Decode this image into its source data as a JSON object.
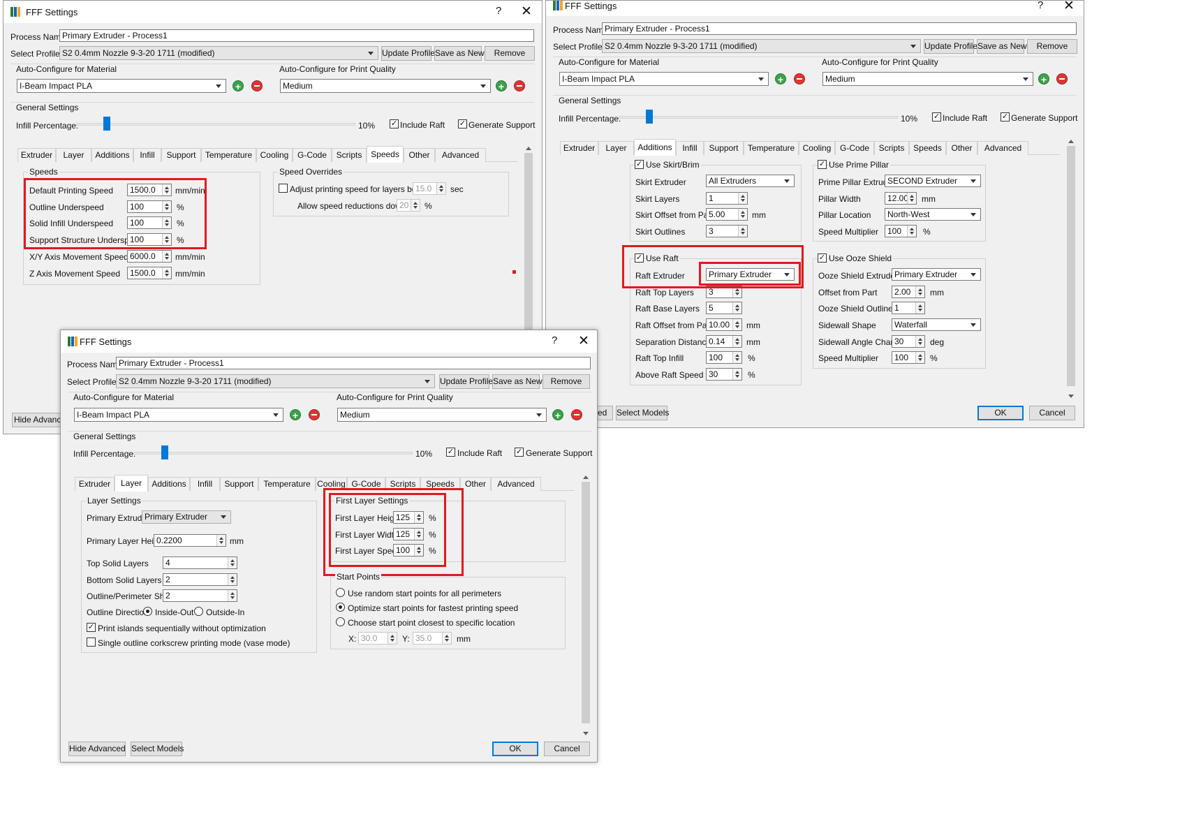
{
  "titles": {
    "win": "FFF Settings",
    "help": "?",
    "close": "✕"
  },
  "labels": {
    "process_name": "Process Name:",
    "select_profile": "Select Profile:",
    "autoconf_material": "Auto-Configure for Material",
    "autoconf_quality": "Auto-Configure for Print Quality",
    "general_settings": "General Settings",
    "infill_percentage": "Infill Percentage:",
    "infill_value": "10%",
    "include_raft": "Include Raft",
    "generate_support": "Generate Support"
  },
  "values": {
    "process_name": "Primary Extruder - Process1",
    "profile": "S2 0.4mm Nozzle 9-3-20 1711 (modified)",
    "material": "I-Beam Impact PLA",
    "quality": "Medium"
  },
  "buttons": {
    "update_profile": "Update Profile",
    "save_as_new": "Save as New",
    "remove": "Remove",
    "hide_advanced": "Hide Advanced",
    "hide_advanced_partial": "Hide Advance",
    "select_models": "Select Models",
    "ok": "OK",
    "cancel": "Cancel",
    "ed_partial": "ed"
  },
  "tabs": {
    "extruder": "Extruder",
    "layer": "Layer",
    "additions": "Additions",
    "infill": "Infill",
    "support": "Support",
    "temperature": "Temperature",
    "cooling": "Cooling",
    "gcode": "G-Code",
    "scripts": "Scripts",
    "speeds": "Speeds",
    "other": "Other",
    "advanced": "Advanced"
  },
  "speeds": {
    "group": "Speeds",
    "rows": [
      {
        "label": "Default Printing Speed",
        "value": "1500.0",
        "unit": "mm/min"
      },
      {
        "label": "Outline Underspeed",
        "value": "100",
        "unit": "%"
      },
      {
        "label": "Solid Infill Underspeed",
        "value": "100",
        "unit": "%"
      },
      {
        "label": "Support Structure Underspeed",
        "value": "100",
        "unit": "%"
      },
      {
        "label": "X/Y Axis Movement Speed",
        "value": "6000.0",
        "unit": "mm/min"
      },
      {
        "label": "Z Axis Movement Speed",
        "value": "1500.0",
        "unit": "mm/min"
      }
    ],
    "overrides_group": "Speed Overrides",
    "adjust_label": "Adjust printing speed for layers below",
    "adjust_value": "15.0",
    "adjust_unit": "sec",
    "allow_label": "Allow speed reductions down to",
    "allow_value": "20",
    "allow_unit": "%"
  },
  "additions": {
    "skirt_title": "Use Skirt/Brim",
    "skirt_extruder_label": "Skirt Extruder",
    "skirt_extruder": "All Extruders",
    "skirt_layers_label": "Skirt Layers",
    "skirt_layers": "1",
    "skirt_offset_label": "Skirt Offset from Part",
    "skirt_offset": "5.00",
    "skirt_offset_unit": "mm",
    "skirt_outlines_label": "Skirt Outlines",
    "skirt_outlines": "3",
    "raft_title": "Use Raft",
    "raft_extruder_label": "Raft Extruder",
    "raft_extruder": "Primary Extruder",
    "raft_top_label": "Raft Top Layers",
    "raft_top": "3",
    "raft_base_label": "Raft Base Layers",
    "raft_base": "5",
    "raft_offset_label": "Raft Offset from Part",
    "raft_offset": "10.00",
    "raft_offset_unit": "mm",
    "sep_label": "Separation Distance",
    "sep_value": "0.14",
    "sep_unit": "mm",
    "raft_infill_label": "Raft Top Infill",
    "raft_infill": "100",
    "raft_infill_unit": "%",
    "above_label": "Above Raft Speed",
    "above_value": "30",
    "above_unit": "%",
    "pillar_title": "Use Prime Pillar",
    "pillar_extruder_label": "Prime Pillar Extruder",
    "pillar_extruder": "SECOND Extruder",
    "pillar_width_label": "Pillar Width",
    "pillar_width": "12.00",
    "pillar_width_unit": "mm",
    "pillar_loc_label": "Pillar Location",
    "pillar_loc": "North-West",
    "pillar_speed_label": "Speed Multiplier",
    "pillar_speed": "100",
    "pillar_speed_unit": "%",
    "ooze_title": "Use Ooze Shield",
    "ooze_extruder_label": "Ooze Shield Extruder",
    "ooze_extruder": "Primary Extruder",
    "ooze_offset_label": "Offset from Part",
    "ooze_offset": "2.00",
    "ooze_offset_unit": "mm",
    "ooze_outlines_label": "Ooze Shield Outlines",
    "ooze_outlines": "1",
    "sidewall_label": "Sidewall Shape",
    "sidewall": "Waterfall",
    "angle_label": "Sidewall Angle Change",
    "angle": "30",
    "angle_unit": "deg",
    "ooze_speed_label": "Speed Multiplier",
    "ooze_speed": "100",
    "ooze_speed_unit": "%"
  },
  "layer": {
    "group": "Layer Settings",
    "primary_extruder_label": "Primary Extruder",
    "primary_extruder": "Primary Extruder",
    "primary_height_label": "Primary Layer Height",
    "primary_height": "0.2200",
    "primary_height_unit": "mm",
    "top_label": "Top Solid Layers",
    "top": "4",
    "bottom_label": "Bottom Solid Layers",
    "bottom": "2",
    "outline_label": "Outline/Perimeter Shells",
    "outline": "2",
    "direction_label": "Outline Direction:",
    "inside_out": "Inside-Out",
    "outside_in": "Outside-In",
    "islands": "Print islands sequentially without optimization",
    "vase": "Single outline corkscrew printing mode (vase mode)",
    "first_group": "First Layer Settings",
    "first_height_label": "First Layer Height",
    "first_height": "125",
    "first_width_label": "First Layer Width",
    "first_width": "125",
    "first_speed_label": "First Layer Speed",
    "first_speed": "100",
    "pct": "%",
    "start_group": "Start Points",
    "start_random": "Use random start points for all perimeters",
    "start_optimize": "Optimize start points for fastest printing speed",
    "start_closest": "Choose start point closest to specific location",
    "x_label": "X:",
    "x_value": "30.0",
    "y_label": "Y:",
    "y_value": "35.0",
    "xy_unit": "mm"
  }
}
